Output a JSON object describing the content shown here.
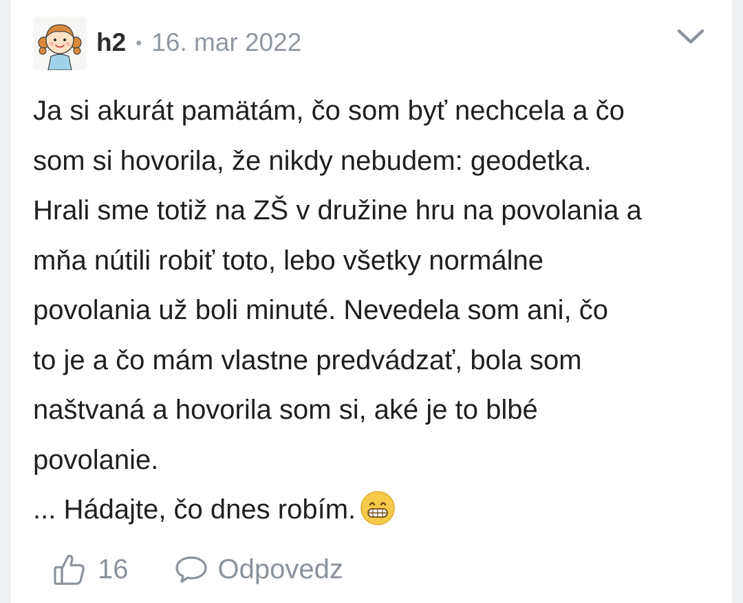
{
  "comment": {
    "username": "h2",
    "separator": "•",
    "date": "16. mar 2022",
    "avatar_icon": "cartoon-girl-avatar",
    "collapse_icon": "chevron-down-icon",
    "lines": [
      "Ja si akurát pamätám, čo som byť nechcela a čo",
      "som si hovorila, že nikdy nebudem: geodetka.",
      "Hrali sme totiž na ZŠ v družine hru na povolania a",
      "mňa nútili robiť toto, lebo všetky normálne",
      "povolania už boli minuté. Nevedela som ani, čo",
      "to je a čo mám vlastne predvádzať, bola som",
      "naštvaná a hovorila som si, aké je to blbé",
      "povolanie."
    ],
    "last_line": "... Hádajte, čo dnes robím.",
    "emoji_icon": "grinning-face-emoji",
    "likes_count": "16",
    "reply_label": "Odpovedz"
  },
  "colors": {
    "page_background": "#eef0f2",
    "card_background": "#ffffff",
    "text": "#1f1f1f",
    "muted": "#8a929c",
    "emoji_yellow": "#f7c948"
  }
}
